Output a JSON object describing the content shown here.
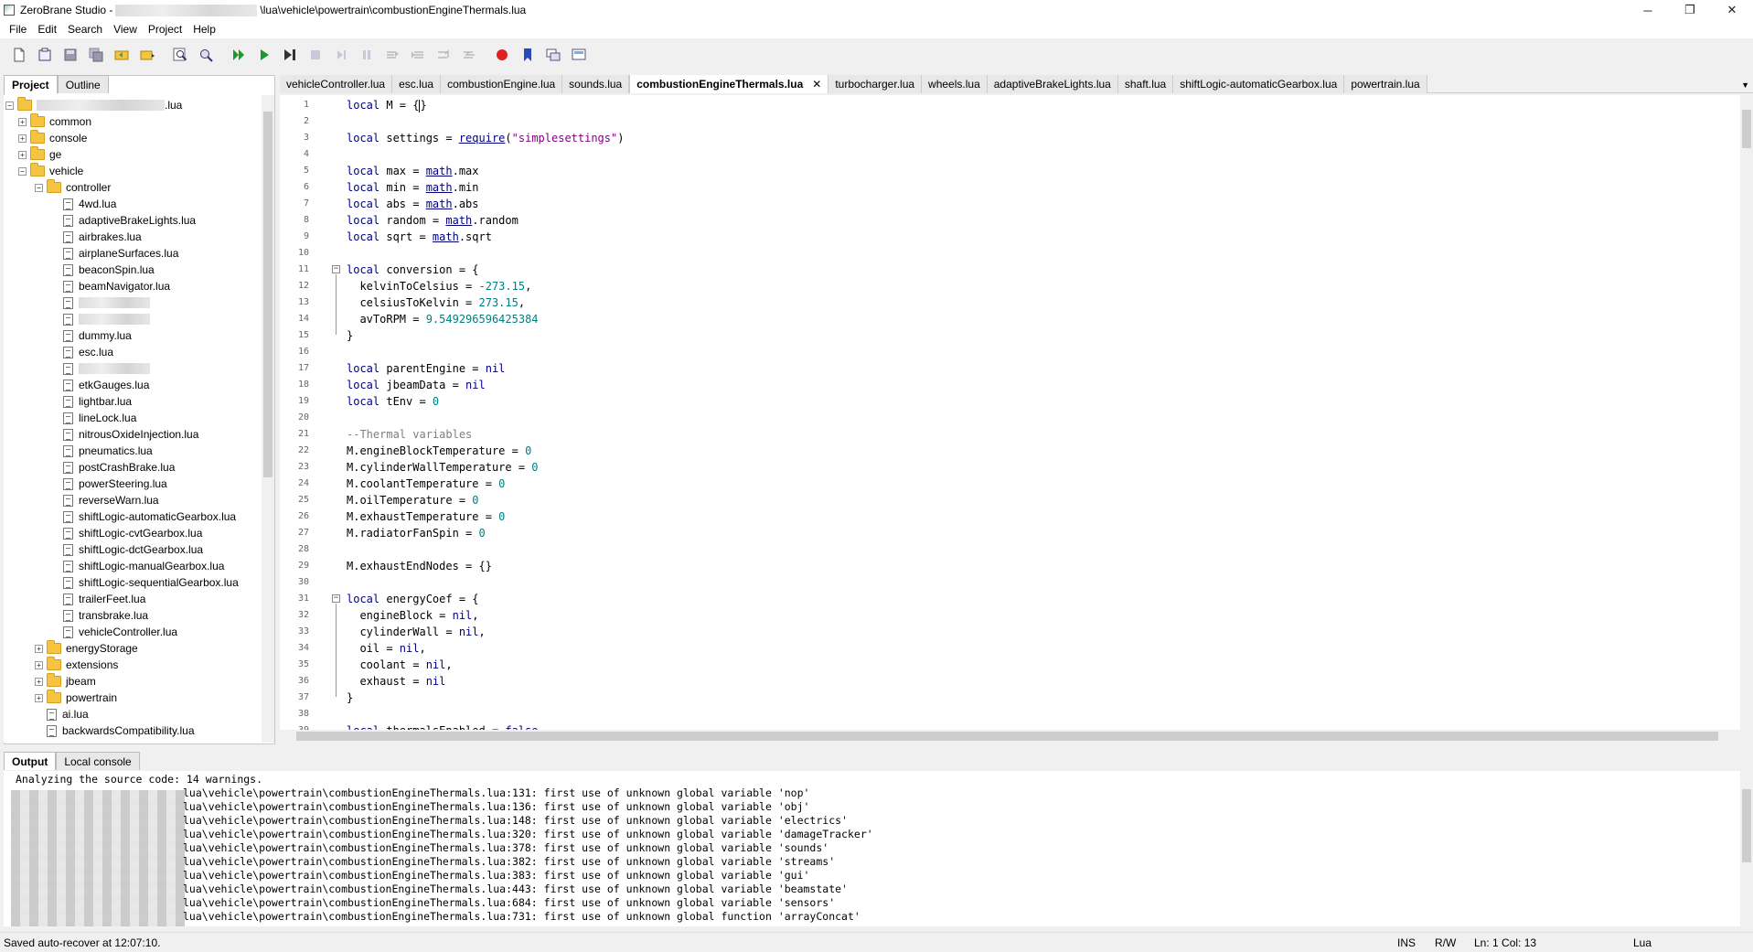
{
  "window": {
    "title_prefix": "ZeroBrane Studio -",
    "title_suffix": "\\lua\\vehicle\\powertrain\\combustionEngineThermals.lua",
    "minimize": "─",
    "maximize": "❐",
    "close": "✕"
  },
  "menu": [
    "File",
    "Edit",
    "Search",
    "View",
    "Project",
    "Help"
  ],
  "left_panel": {
    "tabs": [
      "Project",
      "Outline"
    ],
    "root_suffix": ".lua",
    "tree": [
      {
        "type": "folder",
        "label": "common",
        "level": 1,
        "expander": "+"
      },
      {
        "type": "folder",
        "label": "console",
        "level": 1,
        "expander": "+"
      },
      {
        "type": "folder",
        "label": "ge",
        "level": 1,
        "expander": "+"
      },
      {
        "type": "folder",
        "label": "vehicle",
        "level": 1,
        "expander": "−"
      },
      {
        "type": "folder",
        "label": "controller",
        "level": 2,
        "expander": "−"
      },
      {
        "type": "file",
        "label": "4wd.lua",
        "level": 3
      },
      {
        "type": "file",
        "label": "adaptiveBrakeLights.lua",
        "level": 3
      },
      {
        "type": "file",
        "label": "airbrakes.lua",
        "level": 3
      },
      {
        "type": "file",
        "label": "airplaneSurfaces.lua",
        "level": 3
      },
      {
        "type": "file",
        "label": "beaconSpin.lua",
        "level": 3
      },
      {
        "type": "file",
        "label": "beamNavigator.lua",
        "level": 3
      },
      {
        "type": "file",
        "label": "",
        "level": 3,
        "blurred": true
      },
      {
        "type": "file",
        "label": "",
        "level": 3,
        "blurred": true
      },
      {
        "type": "file",
        "label": "dummy.lua",
        "level": 3
      },
      {
        "type": "file",
        "label": "esc.lua",
        "level": 3
      },
      {
        "type": "file",
        "label": "",
        "level": 3,
        "blurred": true
      },
      {
        "type": "file",
        "label": "etkGauges.lua",
        "level": 3
      },
      {
        "type": "file",
        "label": "lightbar.lua",
        "level": 3
      },
      {
        "type": "file",
        "label": "lineLock.lua",
        "level": 3
      },
      {
        "type": "file",
        "label": "nitrousOxideInjection.lua",
        "level": 3
      },
      {
        "type": "file",
        "label": "pneumatics.lua",
        "level": 3
      },
      {
        "type": "file",
        "label": "postCrashBrake.lua",
        "level": 3
      },
      {
        "type": "file",
        "label": "powerSteering.lua",
        "level": 3
      },
      {
        "type": "file",
        "label": "reverseWarn.lua",
        "level": 3
      },
      {
        "type": "file",
        "label": "shiftLogic-automaticGearbox.lua",
        "level": 3
      },
      {
        "type": "file",
        "label": "shiftLogic-cvtGearbox.lua",
        "level": 3
      },
      {
        "type": "file",
        "label": "shiftLogic-dctGearbox.lua",
        "level": 3
      },
      {
        "type": "file",
        "label": "shiftLogic-manualGearbox.lua",
        "level": 3
      },
      {
        "type": "file",
        "label": "shiftLogic-sequentialGearbox.lua",
        "level": 3
      },
      {
        "type": "file",
        "label": "trailerFeet.lua",
        "level": 3
      },
      {
        "type": "file",
        "label": "transbrake.lua",
        "level": 3
      },
      {
        "type": "file",
        "label": "vehicleController.lua",
        "level": 3
      },
      {
        "type": "folder",
        "label": "energyStorage",
        "level": 2,
        "expander": "+"
      },
      {
        "type": "folder",
        "label": "extensions",
        "level": 2,
        "expander": "+"
      },
      {
        "type": "folder",
        "label": "jbeam",
        "level": 2,
        "expander": "+"
      },
      {
        "type": "folder",
        "label": "powertrain",
        "level": 2,
        "expander": "+"
      },
      {
        "type": "file",
        "label": "ai.lua",
        "level": 2
      },
      {
        "type": "file",
        "label": "backwardsCompatibility.lua",
        "level": 2
      }
    ]
  },
  "editor_tabs": [
    {
      "label": "vehicleController.lua",
      "active": false
    },
    {
      "label": "esc.lua",
      "active": false
    },
    {
      "label": "combustionEngine.lua",
      "active": false
    },
    {
      "label": "sounds.lua",
      "active": false
    },
    {
      "label": "combustionEngineThermals.lua",
      "active": true
    },
    {
      "label": "turbocharger.lua",
      "active": false
    },
    {
      "label": "wheels.lua",
      "active": false
    },
    {
      "label": "adaptiveBrakeLights.lua",
      "active": false
    },
    {
      "label": "shaft.lua",
      "active": false
    },
    {
      "label": "shiftLogic-automaticGearbox.lua",
      "active": false
    },
    {
      "label": "powertrain.lua",
      "active": false
    }
  ],
  "active_tab_close": "✕",
  "code_lines": [
    [
      [
        "kw",
        "local"
      ],
      [
        "t",
        " M = {"
      ],
      [
        "t",
        "}"
      ]
    ],
    [],
    [
      [
        "kw",
        "local"
      ],
      [
        "t",
        " settings = "
      ],
      [
        "fn",
        "require"
      ],
      [
        "t",
        "("
      ],
      [
        "str",
        "\"simplesettings\""
      ],
      [
        "t",
        ")"
      ]
    ],
    [],
    [
      [
        "kw",
        "local"
      ],
      [
        "t",
        " max = "
      ],
      [
        "fn",
        "math"
      ],
      [
        "t",
        ".max"
      ]
    ],
    [
      [
        "kw",
        "local"
      ],
      [
        "t",
        " min = "
      ],
      [
        "fn",
        "math"
      ],
      [
        "t",
        ".min"
      ]
    ],
    [
      [
        "kw",
        "local"
      ],
      [
        "t",
        " abs = "
      ],
      [
        "fn",
        "math"
      ],
      [
        "t",
        ".abs"
      ]
    ],
    [
      [
        "kw",
        "local"
      ],
      [
        "t",
        " random = "
      ],
      [
        "fn",
        "math"
      ],
      [
        "t",
        ".random"
      ]
    ],
    [
      [
        "kw",
        "local"
      ],
      [
        "t",
        " sqrt = "
      ],
      [
        "fn",
        "math"
      ],
      [
        "t",
        ".sqrt"
      ]
    ],
    [],
    [
      [
        "kw",
        "local"
      ],
      [
        "t",
        " conversion = {"
      ]
    ],
    [
      [
        "t",
        "  kelvinToCelsius = "
      ],
      [
        "num",
        "-273.15"
      ],
      [
        "t",
        ","
      ]
    ],
    [
      [
        "t",
        "  celsiusToKelvin = "
      ],
      [
        "num",
        "273.15"
      ],
      [
        "t",
        ","
      ]
    ],
    [
      [
        "t",
        "  avToRPM = "
      ],
      [
        "num",
        "9.549296596425384"
      ]
    ],
    [
      [
        "t",
        "}"
      ]
    ],
    [],
    [
      [
        "kw",
        "local"
      ],
      [
        "t",
        " parentEngine = "
      ],
      [
        "kw",
        "nil"
      ]
    ],
    [
      [
        "kw",
        "local"
      ],
      [
        "t",
        " jbeamData = "
      ],
      [
        "kw",
        "nil"
      ]
    ],
    [
      [
        "kw",
        "local"
      ],
      [
        "t",
        " tEnv = "
      ],
      [
        "num",
        "0"
      ]
    ],
    [],
    [
      [
        "cmt",
        "--Thermal variables"
      ]
    ],
    [
      [
        "t",
        "M.engineBlockTemperature = "
      ],
      [
        "num",
        "0"
      ]
    ],
    [
      [
        "t",
        "M.cylinderWallTemperature = "
      ],
      [
        "num",
        "0"
      ]
    ],
    [
      [
        "t",
        "M.coolantTemperature = "
      ],
      [
        "num",
        "0"
      ]
    ],
    [
      [
        "t",
        "M.oilTemperature = "
      ],
      [
        "num",
        "0"
      ]
    ],
    [
      [
        "t",
        "M.exhaustTemperature = "
      ],
      [
        "num",
        "0"
      ]
    ],
    [
      [
        "t",
        "M.radiatorFanSpin = "
      ],
      [
        "num",
        "0"
      ]
    ],
    [],
    [
      [
        "t",
        "M.exhaustEndNodes = {}"
      ]
    ],
    [],
    [
      [
        "kw",
        "local"
      ],
      [
        "t",
        " energyCoef = {"
      ]
    ],
    [
      [
        "t",
        "  engineBlock = "
      ],
      [
        "kw",
        "nil"
      ],
      [
        "t",
        ","
      ]
    ],
    [
      [
        "t",
        "  cylinderWall = "
      ],
      [
        "kw",
        "nil"
      ],
      [
        "t",
        ","
      ]
    ],
    [
      [
        "t",
        "  oil = "
      ],
      [
        "kw",
        "nil"
      ],
      [
        "t",
        ","
      ]
    ],
    [
      [
        "t",
        "  coolant = "
      ],
      [
        "kw",
        "nil"
      ],
      [
        "t",
        ","
      ]
    ],
    [
      [
        "t",
        "  exhaust = "
      ],
      [
        "kw",
        "nil"
      ]
    ],
    [
      [
        "t",
        "}"
      ]
    ],
    [],
    [
      [
        "kw",
        "local"
      ],
      [
        "t",
        " thermalsEnabled = "
      ],
      [
        "kw",
        "false"
      ]
    ]
  ],
  "output": {
    "tabs": [
      "Output",
      "Local console"
    ],
    "header": "Analyzing the source code: 14 warnings.",
    "lines": [
      "lua\\vehicle\\powertrain\\combustionEngineThermals.lua:131: first use of unknown global variable 'nop'",
      "lua\\vehicle\\powertrain\\combustionEngineThermals.lua:136: first use of unknown global variable 'obj'",
      "lua\\vehicle\\powertrain\\combustionEngineThermals.lua:148: first use of unknown global variable 'electrics'",
      "lua\\vehicle\\powertrain\\combustionEngineThermals.lua:320: first use of unknown global variable 'damageTracker'",
      "lua\\vehicle\\powertrain\\combustionEngineThermals.lua:378: first use of unknown global variable 'sounds'",
      "lua\\vehicle\\powertrain\\combustionEngineThermals.lua:382: first use of unknown global variable 'streams'",
      "lua\\vehicle\\powertrain\\combustionEngineThermals.lua:383: first use of unknown global variable 'gui'",
      "lua\\vehicle\\powertrain\\combustionEngineThermals.lua:443: first use of unknown global variable 'beamstate'",
      "lua\\vehicle\\powertrain\\combustionEngineThermals.lua:684: first use of unknown global variable 'sensors'",
      "lua\\vehicle\\powertrain\\combustionEngineThermals.lua:731: first use of unknown global function 'arrayConcat'"
    ]
  },
  "status": {
    "message": "Saved auto-recover at 12:07:10.",
    "mode": "INS",
    "rw": "R/W",
    "position": "Ln: 1 Col: 13",
    "language": "Lua"
  },
  "toolbar_icons": [
    "new-file-icon",
    "open-file-icon",
    "save-icon",
    "save-all-icon",
    "project-dir-icon",
    "project-dir-choose-icon",
    "find-icon",
    "find-in-files-icon",
    "run-icon",
    "debug-start-icon",
    "run-to-cursor-icon",
    "stop-icon",
    "step-icon",
    "break-icon",
    "step-over-icon",
    "step-into-icon",
    "step-out-icon",
    "toggle-breakpoint-icon",
    "bookmark-icon",
    "stack-window-icon",
    "watch-window-icon"
  ],
  "colors": {
    "keyword": "#00007f",
    "string": "#7f007f",
    "number": "#007f7f",
    "comment": "#7f7f7f",
    "folder": "#f5c542"
  }
}
